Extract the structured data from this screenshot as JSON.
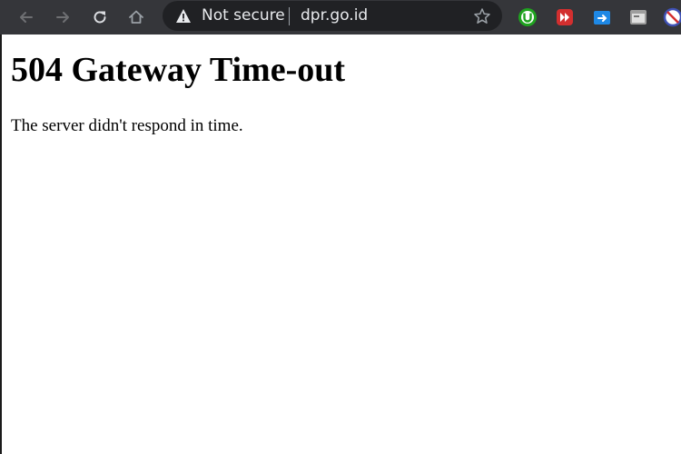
{
  "browser": {
    "toolbar_color": "#35363a",
    "omnibox_color": "#202124",
    "nav": {
      "back": {
        "icon": "arrow-left-icon",
        "enabled": false
      },
      "forward": {
        "icon": "arrow-right-icon",
        "enabled": false
      },
      "reload": {
        "icon": "reload-icon"
      },
      "home": {
        "icon": "home-icon"
      }
    },
    "omnibox": {
      "security_icon": "warning-triangle-icon",
      "security_label": "Not secure",
      "url": "dpr.go.id",
      "bookmark_icon": "star-outline-icon"
    },
    "extensions": [
      {
        "name": "utorrent-icon",
        "color": "#1fa31f"
      },
      {
        "name": "red-forward-icon",
        "color": "#d32f2f"
      },
      {
        "name": "blue-arrow-icon",
        "color": "#1e88e5"
      },
      {
        "name": "gray-window-icon",
        "color": "#9e9e9e"
      },
      {
        "name": "blocked-circle-icon",
        "color": "#3f51b5"
      }
    ]
  },
  "page": {
    "heading": "504 Gateway Time-out",
    "message": "The server didn't respond in time."
  }
}
